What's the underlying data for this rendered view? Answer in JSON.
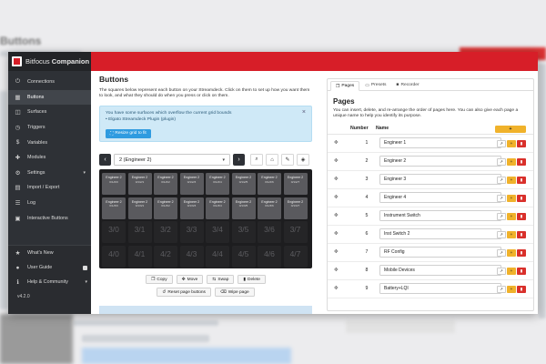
{
  "background": {
    "title": "Buttons"
  },
  "app": {
    "name_plain": "Bitfocus",
    "name_bold": "Companion",
    "version": "v4.2.0"
  },
  "sidebar": {
    "items": [
      {
        "label": "Connections",
        "icon": "plug-icon"
      },
      {
        "label": "Buttons",
        "icon": "grid-icon"
      },
      {
        "label": "Surfaces",
        "icon": "gamepad-icon"
      },
      {
        "label": "Triggers",
        "icon": "clock-icon"
      },
      {
        "label": "Variables",
        "icon": "dollar-icon"
      },
      {
        "label": "Modules",
        "icon": "puzzle-icon"
      },
      {
        "label": "Settings",
        "icon": "gear-icon"
      },
      {
        "label": "Import / Export",
        "icon": "file-icon"
      },
      {
        "label": "Log",
        "icon": "log-icon"
      },
      {
        "label": "Interactive Buttons",
        "icon": "cast-icon"
      }
    ],
    "bottom": [
      {
        "label": "What's New",
        "icon": "star-icon"
      },
      {
        "label": "User Guide",
        "icon": "user-icon"
      },
      {
        "label": "Help & Community",
        "icon": "info-icon"
      }
    ]
  },
  "buttons": {
    "title": "Buttons",
    "description": "The squares below represent each button on your Streamdeck. Click on them to set up how you want them to look, and what they should do when you press or click on them.",
    "alert_line1": "You have some surfaces which overflow the current grid bounds",
    "alert_line2": "• Elgato Streamdeck Plugin (plugin)",
    "resize_label": "Resize grid to fit",
    "page_select": "2 (Engineer 2)",
    "grid_row1": [
      {
        "name": "Engineer 2",
        "coord": "0/1/2/0"
      },
      {
        "name": "Engineer 2",
        "coord": "0/1/2/1"
      },
      {
        "name": "Engineer 2",
        "coord": "0/1/2/2"
      },
      {
        "name": "Engineer 2",
        "coord": "0/1/2/3"
      },
      {
        "name": "Engineer 2",
        "coord": "0/1/2/4"
      },
      {
        "name": "Engineer 2",
        "coord": "0/1/2/5"
      },
      {
        "name": "Engineer 2",
        "coord": "0/1/2/6"
      },
      {
        "name": "Engineer 2",
        "coord": "0/1/2/7"
      }
    ],
    "grid_row2": [
      {
        "name": "Engineer 2",
        "coord": "0/1/3/0"
      },
      {
        "name": "Engineer 2",
        "coord": "0/1/3/1"
      },
      {
        "name": "Engineer 2",
        "coord": "0/1/3/2"
      },
      {
        "name": "Engineer 2",
        "coord": "0/1/3/3"
      },
      {
        "name": "Engineer 2",
        "coord": "0/1/3/4"
      },
      {
        "name": "Engineer 2",
        "coord": "0/1/3/5"
      },
      {
        "name": "Engineer 2",
        "coord": "0/1/3/6"
      },
      {
        "name": "Engineer 2",
        "coord": "0/1/3/7"
      }
    ],
    "grid_row3": [
      "3/0",
      "3/1",
      "3/2",
      "3/3",
      "3/4",
      "3/5",
      "3/6",
      "3/7"
    ],
    "grid_row4": [
      "4/0",
      "4/1",
      "4/2",
      "4/3",
      "4/4",
      "4/5",
      "4/6",
      "4/7"
    ],
    "copy_label": "Copy",
    "move_label": "Move",
    "swap_label": "Swap",
    "delete_label": "Delete",
    "reset_label": "Reset page buttons",
    "wipe_label": "Wipe page"
  },
  "pages": {
    "tabs": [
      {
        "label": "Pages"
      },
      {
        "label": "Presets"
      },
      {
        "label": "Recorder"
      }
    ],
    "title": "Pages",
    "description": "You can insert, delete, and re-arrange the order of pages here. You can also give each page a unique name to help you identify its purpose.",
    "col_number": "Number",
    "col_name": "Name",
    "add_label": "+",
    "rows": [
      {
        "number": "1",
        "name": "Engineer 1"
      },
      {
        "number": "2",
        "name": "Engineer 2"
      },
      {
        "number": "3",
        "name": "Engineer 3"
      },
      {
        "number": "4",
        "name": "Engineer 4"
      },
      {
        "number": "5",
        "name": "Instrument Switch"
      },
      {
        "number": "6",
        "name": "Inst Switch 2"
      },
      {
        "number": "7",
        "name": "RF Config"
      },
      {
        "number": "8",
        "name": "Mobile Devices"
      },
      {
        "number": "9",
        "name": "Battery+LQI"
      }
    ]
  }
}
